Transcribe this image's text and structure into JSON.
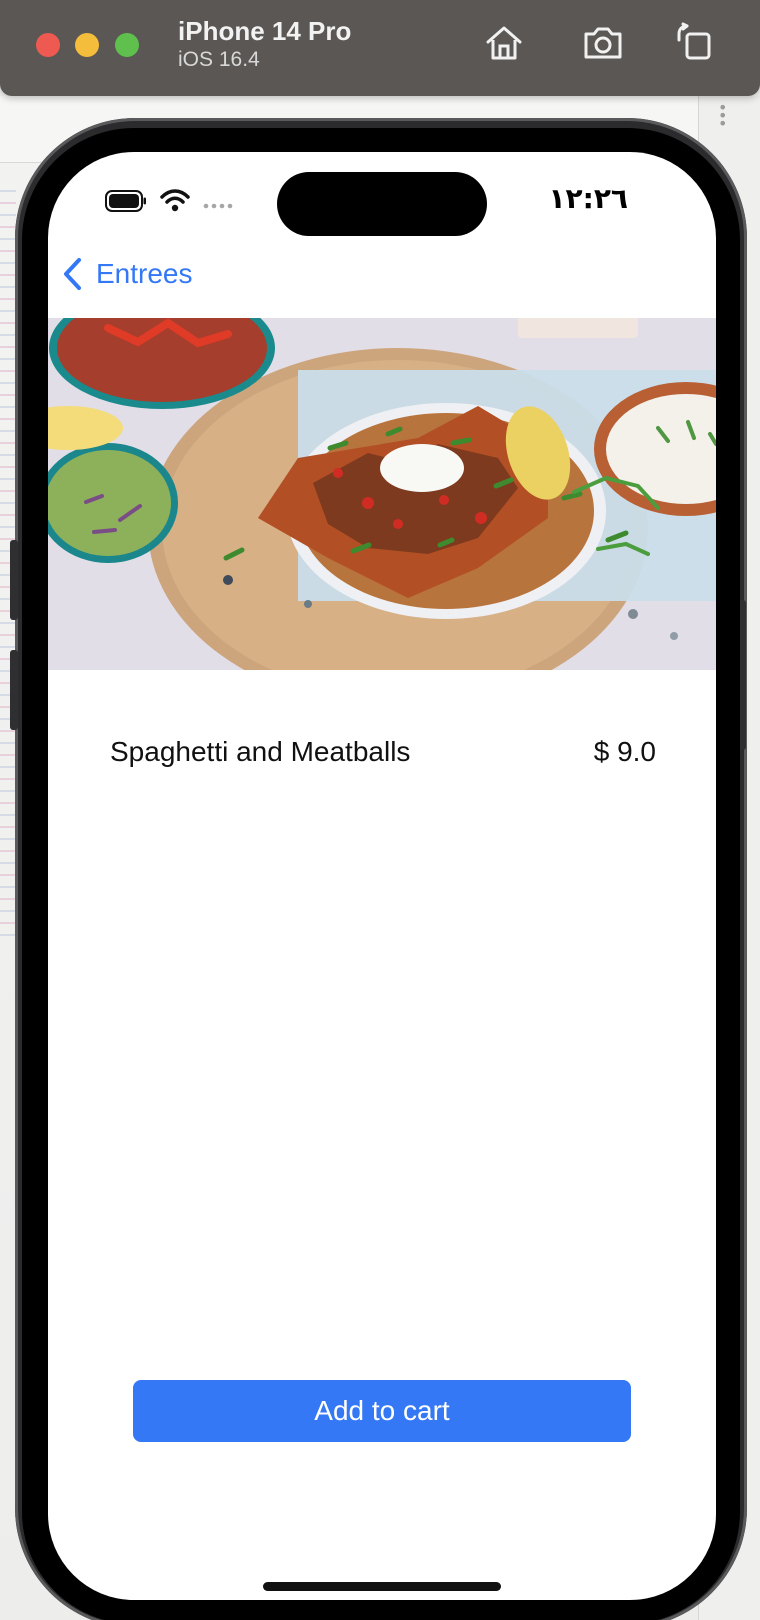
{
  "window": {
    "device_name": "iPhone 14 Pro",
    "os_version": "iOS 16.4",
    "controls": {
      "home": "home-icon",
      "screenshot": "camera-icon",
      "rotate": "rotate-icon"
    }
  },
  "status_bar": {
    "time": "١٢:٢٦",
    "icons": [
      "battery-icon",
      "wifi-icon",
      "cellular-icon"
    ]
  },
  "navigation": {
    "back_label": "Entrees",
    "back_icon": "chevron-left-icon"
  },
  "hero_image": {
    "icon": "food-photo"
  },
  "item": {
    "name": "Spaghetti and Meatballs",
    "price": "$ 9.0"
  },
  "actions": {
    "add_to_cart_label": "Add to cart"
  },
  "colors": {
    "accent": "#3478f6",
    "window_bar": "#5b5754",
    "screen_background": "#ffffff"
  }
}
